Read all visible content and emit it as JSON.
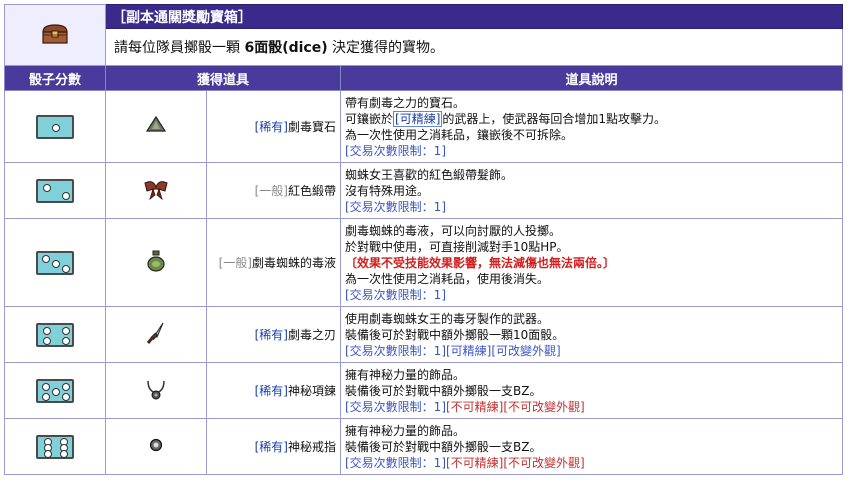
{
  "title": "［副本通關獎勵寶箱］",
  "subtitle_pre": "請每位隊員擲骰一顆 ",
  "subtitle_bold": "6面骰(dice)",
  "subtitle_post": " 決定獲得的寶物。",
  "headers": {
    "dice": "骰子分數",
    "item": "獲得道具",
    "desc": "道具說明"
  },
  "rows": [
    {
      "dice": 1,
      "icon": "gem-icon",
      "rarity": "[稀有]",
      "rarity_type": "rare",
      "name": "劇毒寶石",
      "lines": [
        [
          {
            "t": "帶有劇毒之力的寶石。",
            "c": ""
          }
        ],
        [
          {
            "t": "可鑲嵌於",
            "c": ""
          },
          {
            "t": "[可精練]",
            "c": "bluebox"
          },
          {
            "t": "的武器上，使武器每回合增加1點攻擊力。",
            "c": ""
          }
        ],
        [
          {
            "t": "為一次性使用之消耗品，鑲嵌後不可拆除。",
            "c": ""
          }
        ],
        [
          {
            "t": "[交易次數限制：1]",
            "c": "blue"
          }
        ]
      ]
    },
    {
      "dice": 2,
      "icon": "ribbon-icon",
      "rarity": "[一般]",
      "rarity_type": "common",
      "name": "紅色緞帶",
      "lines": [
        [
          {
            "t": "蜘蛛女王喜歡的紅色緞帶髮飾。",
            "c": ""
          }
        ],
        [
          {
            "t": "沒有特殊用途。",
            "c": ""
          }
        ],
        [
          {
            "t": "[交易次數限制：1]",
            "c": "blue"
          }
        ]
      ]
    },
    {
      "dice": 3,
      "icon": "poison-jar-icon",
      "rarity": "[一般]",
      "rarity_type": "common",
      "name": "劇毒蜘蛛的毒液",
      "lines": [
        [
          {
            "t": "劇毒蜘蛛的毒液，可以向討厭的人投擲。",
            "c": ""
          }
        ],
        [
          {
            "t": "於對戰中使用，可直接削減對手10點HP。",
            "c": ""
          }
        ],
        [
          {
            "t": "〔效果不受技能效果影響，無法減傷也無法兩倍。〕",
            "c": "redb"
          }
        ],
        [
          {
            "t": "為一次性使用之消耗品，使用後消失。",
            "c": ""
          }
        ],
        [
          {
            "t": "[交易次數限制：1]",
            "c": "blue"
          }
        ]
      ]
    },
    {
      "dice": 4,
      "icon": "dagger-icon",
      "rarity": "[稀有]",
      "rarity_type": "rare",
      "name": "劇毒之刃",
      "lines": [
        [
          {
            "t": "使用劇毒蜘蛛女王的毒牙製作的武器。",
            "c": ""
          }
        ],
        [
          {
            "t": "裝備後可於對戰中額外擲骰一顆10面骰。",
            "c": ""
          }
        ],
        [
          {
            "t": "[交易次數限制：1][可精練][可改變外觀]",
            "c": "blue"
          }
        ]
      ]
    },
    {
      "dice": 5,
      "icon": "necklace-icon",
      "rarity": "[稀有]",
      "rarity_type": "rare",
      "name": "神秘項鍊",
      "lines": [
        [
          {
            "t": "擁有神秘力量的飾品。",
            "c": ""
          }
        ],
        [
          {
            "t": "裝備後可於對戰中額外擲骰一支BZ。",
            "c": ""
          }
        ],
        [
          {
            "t": "[交易次數限制：1]",
            "c": "blue"
          },
          {
            "t": "[不可精練][不可改變外觀]",
            "c": "red"
          }
        ]
      ]
    },
    {
      "dice": 6,
      "icon": "ring-icon",
      "rarity": "[稀有]",
      "rarity_type": "rare",
      "name": "神秘戒指",
      "lines": [
        [
          {
            "t": "擁有神秘力量的飾品。",
            "c": ""
          }
        ],
        [
          {
            "t": "裝備後可於對戰中額外擲骰一支BZ。",
            "c": ""
          }
        ],
        [
          {
            "t": "[交易次數限制：1]",
            "c": "blue"
          },
          {
            "t": "[不可精練][不可改變外觀]",
            "c": "red"
          }
        ]
      ]
    }
  ]
}
